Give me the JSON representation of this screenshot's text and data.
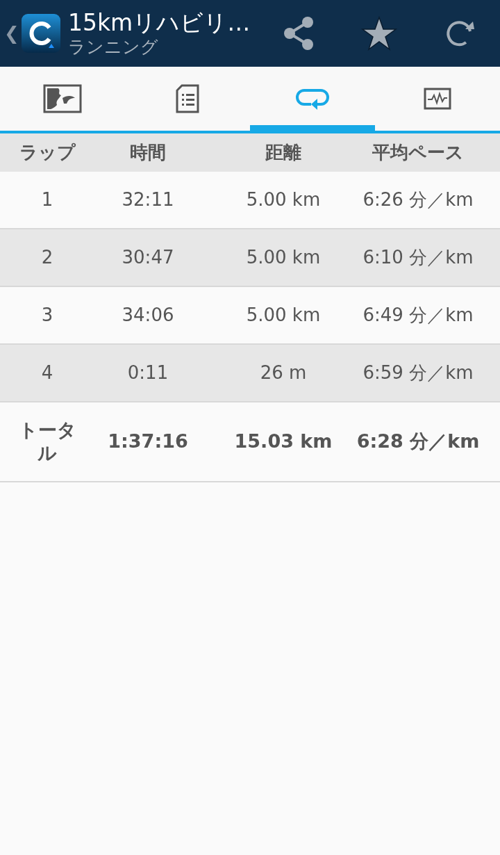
{
  "header": {
    "back": "❮",
    "title": "15kmリハビリ…",
    "subtitle": "ランニング"
  },
  "tabs": [
    {
      "kind": "map",
      "selected": false
    },
    {
      "kind": "document",
      "selected": false
    },
    {
      "kind": "laps",
      "selected": true
    },
    {
      "kind": "chart",
      "selected": false
    }
  ],
  "table": {
    "columns": [
      "ラップ",
      "時間",
      "距離",
      "平均ペース"
    ],
    "rows": [
      {
        "kind": "lap",
        "cells": [
          "1",
          "32:11",
          "5.00 km",
          "6:26 分／km"
        ]
      },
      {
        "kind": "lap",
        "cells": [
          "2",
          "30:47",
          "5.00 km",
          "6:10 分／km"
        ]
      },
      {
        "kind": "lap",
        "cells": [
          "3",
          "34:06",
          "5.00 km",
          "6:49 分／km"
        ]
      },
      {
        "kind": "lap",
        "cells": [
          "4",
          "0:11",
          "26 m",
          "6:59 分／km"
        ]
      },
      {
        "kind": "total",
        "cells": [
          "トータル",
          "1:37:16",
          "15.03 km",
          "6:28 分／km"
        ]
      }
    ]
  }
}
